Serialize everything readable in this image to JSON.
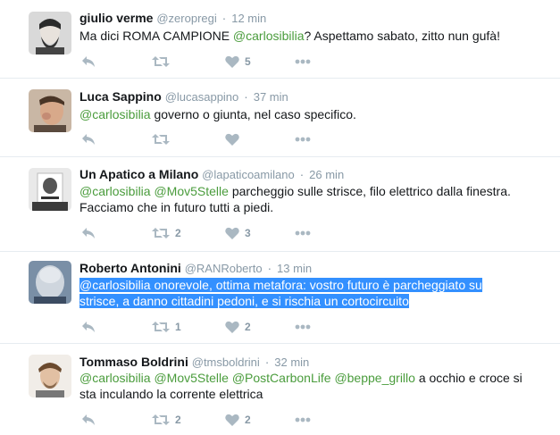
{
  "tweets": [
    {
      "name": "giulio verme",
      "handle": "@zeropregi",
      "sep": "·",
      "time": "12 min",
      "text_pre": "Ma dici ROMA CAMPIONE ",
      "mention1": "@carlosibilia",
      "text_post": "? Aspettamo sabato, zitto nun gufà!",
      "retweets": "",
      "likes": "5"
    },
    {
      "name": "Luca Sappino",
      "handle": "@lucasappino",
      "sep": "·",
      "time": "37 min",
      "mention1": "@carlosibilia",
      "text_post": " governo o giunta, nel caso specifico.",
      "retweets": "",
      "likes": ""
    },
    {
      "name": "Un Apatico a Milano",
      "handle": "@lapaticoamilano",
      "sep": "·",
      "time": "26 min",
      "mention1": "@carlosibilia",
      "mention2": "@Mov5Stelle",
      "text_post": " parcheggio sulle strisce, filo elettrico dalla finestra.",
      "line2": "Facciamo che in futuro tutti a piedi.",
      "retweets": "2",
      "likes": "3"
    },
    {
      "name": "Roberto Antonini",
      "handle": "@RANRoberto",
      "sep": "·",
      "time": "13 min",
      "mention1": "@carlosibilia",
      "text_post": " onorevole, ottima metafora: vostro futuro è parcheggiato su",
      "line2": "strisce, a danno cittadini pedoni, e si rischia un cortocircuito",
      "retweets": "1",
      "likes": "2"
    },
    {
      "name": "Tommaso Boldrini",
      "handle": "@tmsboldrini",
      "sep": "·",
      "time": "32 min",
      "mention1": "@carlosibilia",
      "mention2": "@Mov5Stelle",
      "mention3": "@PostCarbonLife",
      "mention4": "@beppe_grillo",
      "text_post": " a occhio e croce si",
      "line2": "sta inculando la corrente elettrica",
      "retweets": "2",
      "likes": "2"
    }
  ],
  "icons": {
    "reply": "reply-icon",
    "retweet": "retweet-icon",
    "like": "heart-icon",
    "more": "more-icon"
  },
  "colors": {
    "mention": "#4a9c3c",
    "meta": "#8899a6",
    "icon": "#aab8c2",
    "selection": "#3390ff",
    "divider": "#e6ecf0"
  }
}
